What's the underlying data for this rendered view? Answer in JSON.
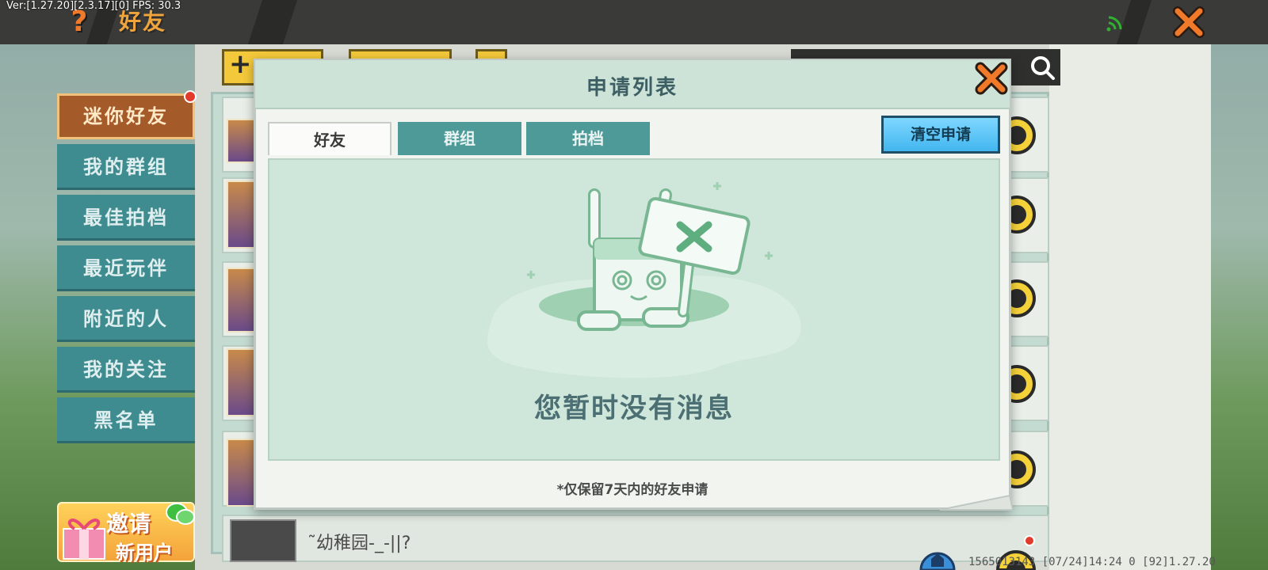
{
  "top_bar": {
    "version": "Ver:[1.27.20][2.3.17][0] FPS: 30.3",
    "title": "好友",
    "help_glyph": "?",
    "icons": [
      "help-icon",
      "signal-icon",
      "close-icon"
    ]
  },
  "sidebar": {
    "items": [
      {
        "label": "迷你好友",
        "active": true
      },
      {
        "label": "我的群组",
        "active": false
      },
      {
        "label": "最佳拍档",
        "active": false
      },
      {
        "label": "最近玩伴",
        "active": false
      },
      {
        "label": "附近的人",
        "active": false
      },
      {
        "label": "我的关注",
        "active": false
      },
      {
        "label": "黑名单",
        "active": false
      }
    ],
    "invite": {
      "line1": "邀请",
      "line2": "新用户"
    }
  },
  "toolbar": {
    "plus_glyph": "+"
  },
  "friend_row": {
    "name": "˜幼稚园-_-||?"
  },
  "footer": {
    "info": "1565013143 [07/24]14:24 0 [92]1.27.20"
  },
  "modal": {
    "title": "申请列表",
    "tabs": [
      {
        "label": "好友",
        "active": true
      },
      {
        "label": "群组",
        "active": false
      },
      {
        "label": "拍档",
        "active": false
      }
    ],
    "clear_button": "清空申请",
    "empty_message": "您暂时没有消息",
    "note": "*仅保留7天内的好友申请"
  },
  "colors": {
    "accent_orange": "#f07a2a",
    "teal": "#4e9a98",
    "modal_header": "#cde3d8",
    "clear_button": "#42b6ef",
    "empty_bg": "#cfe6da"
  }
}
